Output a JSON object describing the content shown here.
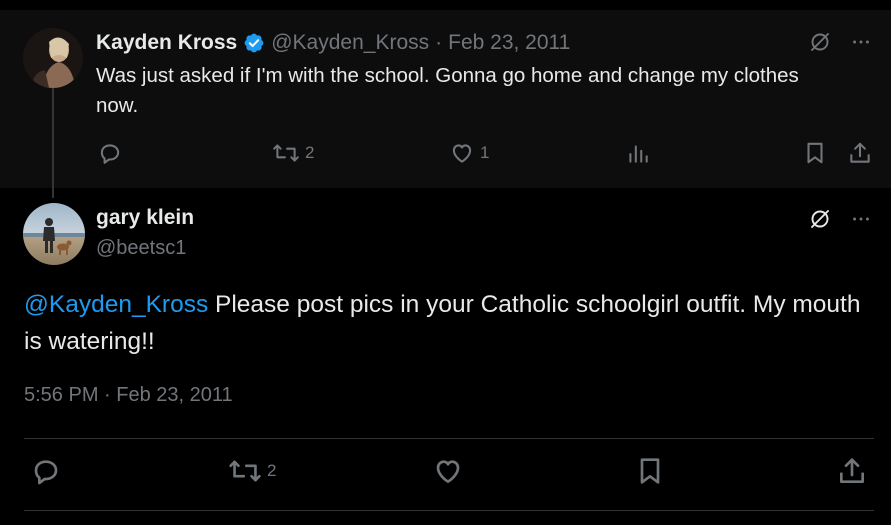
{
  "parent_tweet": {
    "author_name": "Kayden Kross",
    "handle": "@Kayden_Kross",
    "separator": "·",
    "date": "Feb 23, 2011",
    "text": "Was just asked if I'm with the school. Gonna go home and change my clothes now.",
    "verified": true,
    "actions": {
      "reply_count": "",
      "retweet_count": "2",
      "like_count": "1"
    }
  },
  "main_tweet": {
    "author_name": "gary klein",
    "handle": "@beetsc1",
    "mention": "@Kayden_Kross",
    "text": " Please post pics in your Catholic schoolgirl outfit. My mouth is watering!!",
    "timestamp": "5:56 PM · Feb 23, 2011",
    "actions": {
      "retweet_count": "2"
    }
  },
  "colors": {
    "background": "#000000",
    "parent_background": "#0d0d0e",
    "primary_text": "#e7e9ea",
    "secondary_text": "#71767b",
    "accent": "#1d9bf0",
    "divider": "#2f3336"
  },
  "icons": [
    "verified-badge-icon",
    "grok-icon",
    "more-icon",
    "reply-icon",
    "retweet-icon",
    "like-icon",
    "analytics-icon",
    "bookmark-icon",
    "share-icon"
  ]
}
